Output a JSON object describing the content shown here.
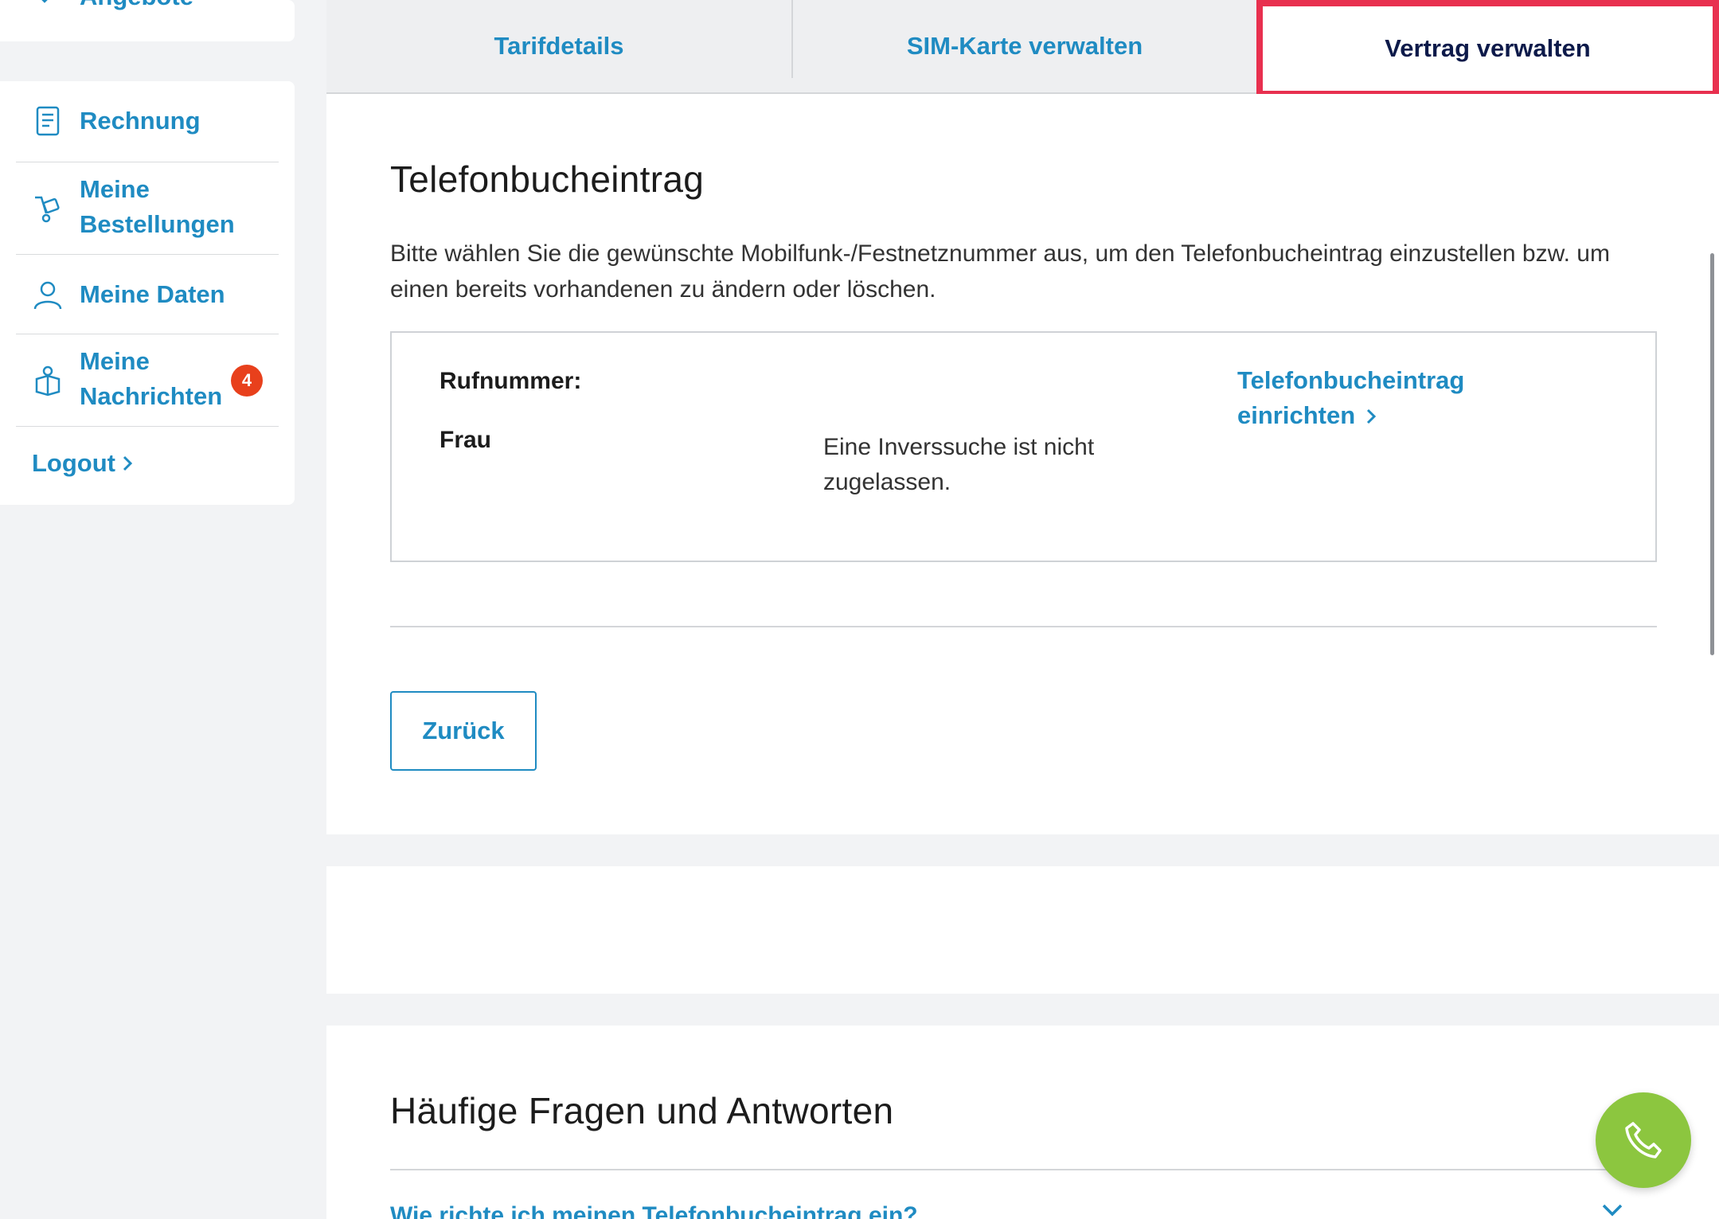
{
  "sidebar": {
    "top_item": {
      "label": "Angebote",
      "icon": "tag-icon"
    },
    "items": [
      {
        "label": "Rechnung",
        "icon": "invoice-icon"
      },
      {
        "label": "Meine Bestellungen",
        "icon": "hand-truck-icon"
      },
      {
        "label": "Meine Daten",
        "icon": "user-icon"
      },
      {
        "label": "Meine Nachrichten",
        "icon": "messages-icon",
        "badge": "4"
      }
    ],
    "logout_label": "Logout"
  },
  "tabs": [
    {
      "label": "Tarifdetails",
      "active": false
    },
    {
      "label": "SIM-Karte verwalten",
      "active": false
    },
    {
      "label": "Vertrag verwalten",
      "active": true
    }
  ],
  "main": {
    "title": "Telefonbucheintrag",
    "intro": "Bitte wählen Sie die gewünschte Mobilfunk-/Festnetznummer aus, um den Telefonbucheintrag einzustellen bzw. um einen bereits vorhandenen zu ändern oder löschen.",
    "entry": {
      "number_label": "Rufnummer:",
      "name": "Frau",
      "note": "Eine Inverssuche ist nicht zugelassen.",
      "link": "Telefonbucheintrag einrichten"
    },
    "back_button": "Zurück"
  },
  "faq": {
    "title": "Häufige Fragen und Antworten",
    "question": "Wie richte ich meinen Telefonbucheintrag ein?"
  },
  "colors": {
    "accent": "#1f8bc2",
    "highlight": "#e8304f",
    "badge": "#e8401c",
    "fab": "#8cc63f"
  }
}
